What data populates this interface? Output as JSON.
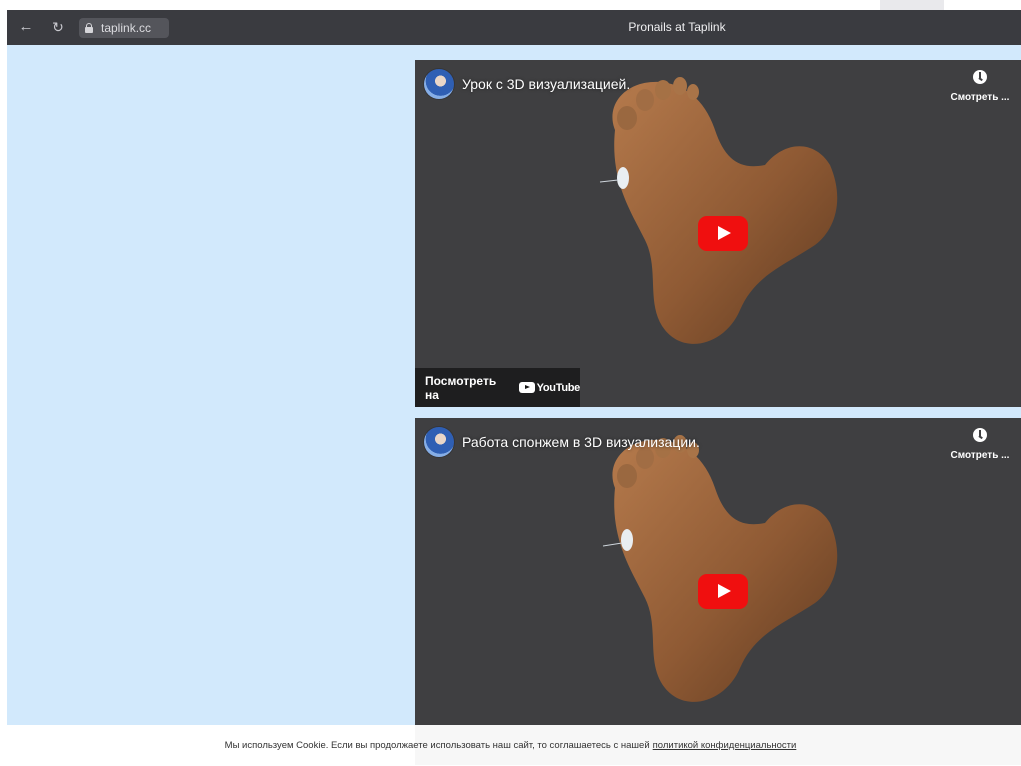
{
  "browser": {
    "url": "taplink.cc",
    "title": "Pronails at Taplink",
    "back_icon": "arrow-left-icon",
    "reload_icon": "reload-icon",
    "lock_icon": "lock-icon"
  },
  "page": {
    "background": "#d2e9fc"
  },
  "videos": [
    {
      "title": "Урок с 3D визуализацией.",
      "watch_later_label": "Смотреть ...",
      "watch_on_label": "Посмотреть на",
      "youtube_label": "YouTube"
    },
    {
      "title": "Работа спонжем в 3D визуализации.",
      "watch_later_label": "Смотреть ..."
    }
  ],
  "cookie": {
    "text": "Мы используем Cookie. Если вы продолжаете использовать наш сайт, то соглашаетесь с нашей",
    "link_text": "политикой конфиденциальности"
  },
  "colors": {
    "browser_bar": "#3a3b40",
    "video_bg": "#3f3f41",
    "play_red": "#f00f0f",
    "page_bg": "#d2e9fc"
  }
}
